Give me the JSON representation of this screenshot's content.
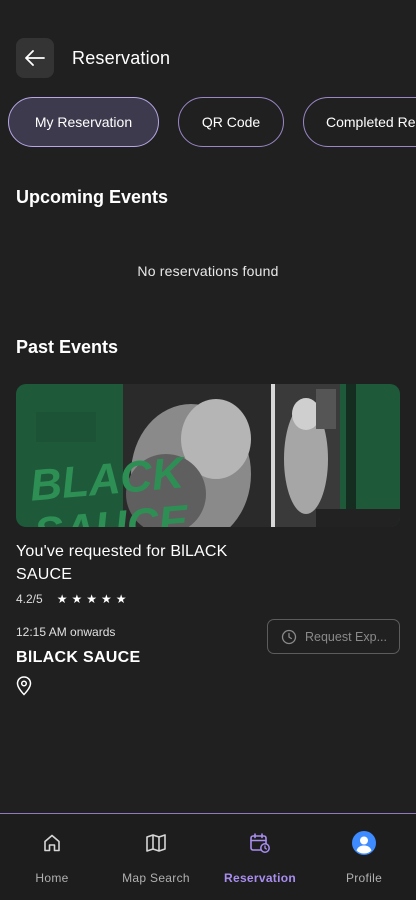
{
  "header": {
    "title": "Reservation",
    "back_icon": "arrow-left-icon"
  },
  "tabs": [
    {
      "label": "My Reservation",
      "active": true
    },
    {
      "label": "QR Code",
      "active": false
    },
    {
      "label": "Completed Re",
      "active": false
    }
  ],
  "upcoming": {
    "title": "Upcoming Events",
    "empty_message": "No reservations found"
  },
  "past": {
    "title": "Past Events",
    "events": [
      {
        "title": "You've requested for BlLACK SAUCE",
        "rating": "4.2/5",
        "stars": 5,
        "time": "12:15 AM onwards",
        "venue": "BlLACK SAUCE",
        "request_button": "Request Exp...",
        "image_text": "BLACK SAUCE"
      }
    ]
  },
  "nav": {
    "items": [
      {
        "label": "Home",
        "icon": "home-icon",
        "active": false
      },
      {
        "label": "Map Search",
        "icon": "map-icon",
        "active": false
      },
      {
        "label": "Reservation",
        "icon": "calendar-clock-icon",
        "active": true
      },
      {
        "label": "Profile",
        "icon": "user-avatar-icon",
        "active": false
      }
    ]
  },
  "colors": {
    "background": "#202020",
    "accent": "#a98ef0",
    "tab_border": "#9b86c8",
    "active_tab_bg": "#3e3a4d"
  }
}
